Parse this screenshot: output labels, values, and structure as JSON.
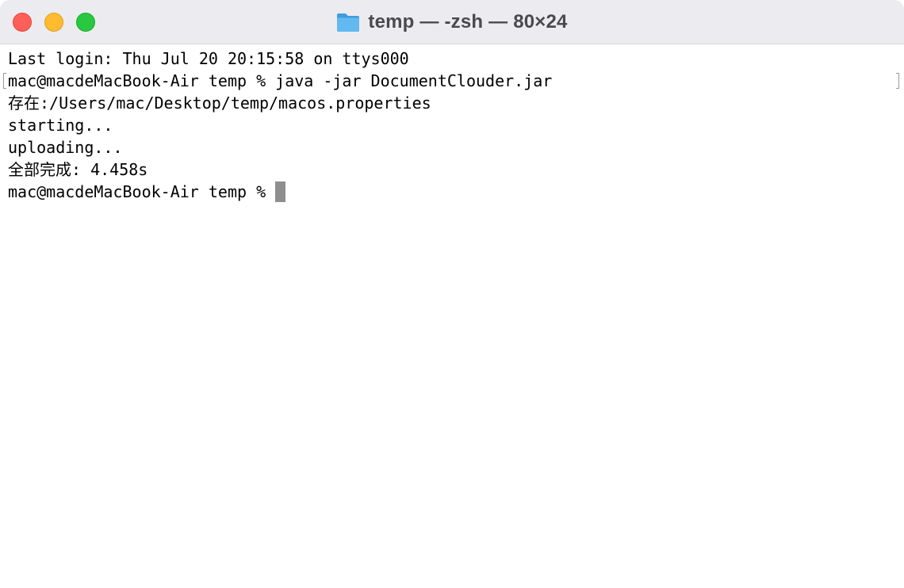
{
  "window": {
    "title": "temp — -zsh — 80×24"
  },
  "terminal": {
    "lines": [
      "Last login: Thu Jul 20 20:15:58 on ttys000",
      "mac@macdeMacBook-Air temp % java -jar DocumentClouder.jar",
      "存在:/Users/mac/Desktop/temp/macos.properties",
      "starting...",
      "uploading...",
      "全部完成: 4.458s"
    ],
    "prompt": "mac@macdeMacBook-Air temp % "
  },
  "icons": {
    "title_icon": "folder-icon"
  },
  "colors": {
    "close": "#ff5f57",
    "minimize": "#febc2e",
    "zoom": "#28c840",
    "folder": "#4aa8e8",
    "cursor": "#8e8e8e"
  }
}
